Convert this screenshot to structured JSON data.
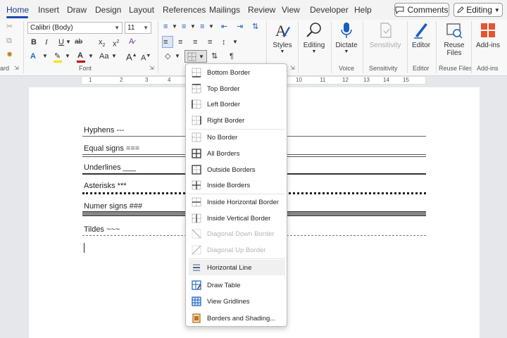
{
  "menu": {
    "tabs": [
      "Home",
      "Insert",
      "Draw",
      "Design",
      "Layout",
      "References",
      "Mailings",
      "Review",
      "View",
      "Developer",
      "Help"
    ],
    "active_tab": "Home",
    "comments_label": "Comments",
    "editing_label": "Editing"
  },
  "ribbon": {
    "font_name": "Calibri (Body)",
    "font_size": "11",
    "groups": {
      "clipboard_partial": "ard",
      "font": "Font",
      "voice": "Voice",
      "sensitivity": "Sensitivity",
      "editor": "Editor",
      "reuse_files": "Reuse Files",
      "addins": "Add-ins"
    },
    "buttons": {
      "styles": "Styles",
      "editing": "Editing",
      "dictate": "Dictate",
      "sensitivity": "Sensitivity",
      "editor": "Editor",
      "reuse_files_line1": "Reuse",
      "reuse_files_line2": "Files",
      "addins": "Add-ins"
    },
    "font_buttons": {
      "bold": "B",
      "italic": "I",
      "underline": "U",
      "strike": "ab",
      "subscript": "x",
      "superscript": "x",
      "grow": "A",
      "shrink": "A",
      "case": "Aa"
    }
  },
  "ruler": {
    "numbers": [
      "1",
      "2",
      "3",
      "4",
      "10",
      "11",
      "12",
      "13",
      "14",
      "15"
    ]
  },
  "document": {
    "lines": [
      "Hyphens ---",
      "Equal signs ===",
      "Underlines ___",
      "Asterisks ***",
      "Numer signs ###",
      "Tildes ~~~"
    ]
  },
  "border_menu": {
    "items": [
      {
        "label": "Bottom Border",
        "icon": "bottom-border-icon",
        "disabled": false
      },
      {
        "label": "Top Border",
        "icon": "top-border-icon",
        "disabled": false
      },
      {
        "label": "Left Border",
        "icon": "left-border-icon",
        "disabled": false
      },
      {
        "label": "Right Border",
        "icon": "right-border-icon",
        "disabled": false
      },
      {
        "label": "No Border",
        "icon": "no-border-icon",
        "disabled": false
      },
      {
        "label": "All Borders",
        "icon": "all-borders-icon",
        "disabled": false
      },
      {
        "label": "Outside Borders",
        "icon": "outside-borders-icon",
        "disabled": false
      },
      {
        "label": "Inside Borders",
        "icon": "inside-borders-icon",
        "disabled": false
      },
      {
        "label": "Inside Horizontal Border",
        "icon": "inside-horizontal-border-icon",
        "disabled": false
      },
      {
        "label": "Inside Vertical Border",
        "icon": "inside-vertical-border-icon",
        "disabled": false
      },
      {
        "label": "Diagonal Down Border",
        "icon": "diagonal-down-border-icon",
        "disabled": true
      },
      {
        "label": "Diagonal Up Border",
        "icon": "diagonal-up-border-icon",
        "disabled": true
      },
      {
        "label": "Horizontal Line",
        "icon": "horizontal-line-icon",
        "disabled": false
      },
      {
        "label": "Draw Table",
        "icon": "draw-table-icon",
        "disabled": false
      },
      {
        "label": "View Gridlines",
        "icon": "view-gridlines-icon",
        "disabled": false
      },
      {
        "label": "Borders and Shading...",
        "icon": "borders-shading-icon",
        "disabled": false
      }
    ],
    "highlighted": "Horizontal Line"
  },
  "colors": {
    "accent": "#1a4bb0",
    "font_color": "#c00000",
    "highlight": "#f5e400"
  }
}
